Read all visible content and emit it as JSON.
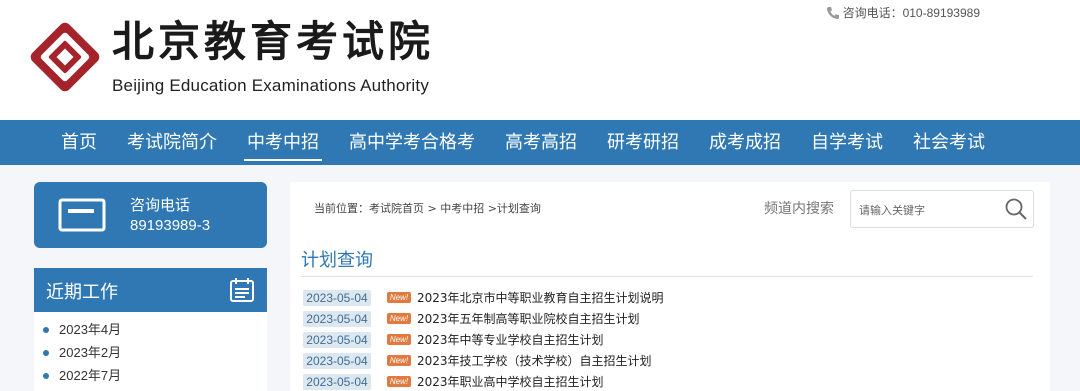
{
  "header": {
    "logo_cn": "北京教育考试院",
    "logo_en": "Beijing Education Examinations Authority",
    "hotline": "咨询电话：010-89193989"
  },
  "nav": {
    "items": [
      {
        "label": "首页"
      },
      {
        "label": "考试院简介"
      },
      {
        "label": "中考中招",
        "active": true
      },
      {
        "label": "高中学考合格考"
      },
      {
        "label": "高考高招"
      },
      {
        "label": "研考研招"
      },
      {
        "label": "成考成招"
      },
      {
        "label": "自学考试"
      },
      {
        "label": "社会考试"
      }
    ]
  },
  "sidebar": {
    "consult_title": "咨询电话",
    "consult_number": "89193989-3",
    "recent_title": "近期工作",
    "recent_items": [
      "2023年4月",
      "2023年2月",
      "2022年7月"
    ]
  },
  "content": {
    "breadcrumb": "当前位置：考试院首页 > 中考中招 >计划查询",
    "search_label": "频道内搜索",
    "search_placeholder": "请输入关键字",
    "section_title": "计划查询",
    "badge_label": "New!",
    "items": [
      {
        "date": "2023-05-04",
        "title": "2023年北京市中等职业教育自主招生计划说明"
      },
      {
        "date": "2023-05-04",
        "title": "2023年五年制高等职业院校自主招生计划"
      },
      {
        "date": "2023-05-04",
        "title": "2023年中等专业学校自主招生计划"
      },
      {
        "date": "2023-05-04",
        "title": "2023年技工学校（技术学校）自主招生计划"
      },
      {
        "date": "2023-05-04",
        "title": "2023年职业高中学校自主招生计划"
      }
    ]
  },
  "colors": {
    "primary": "#2f78b3",
    "logo_red": "#a5242b",
    "badge": "#e07a3f",
    "date_bg": "#dde7f0"
  }
}
